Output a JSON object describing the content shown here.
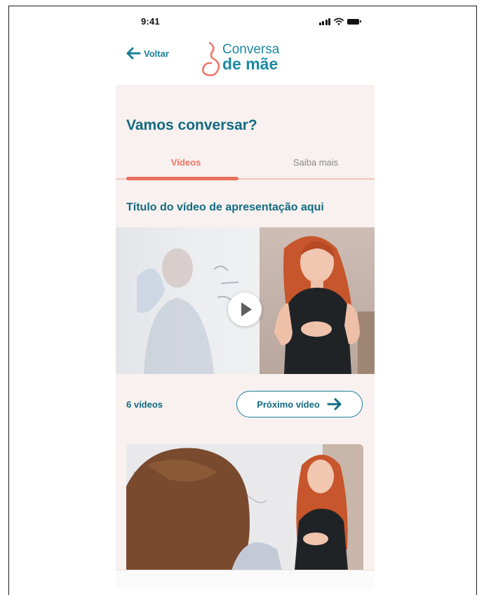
{
  "status_bar": {
    "time": "9:41",
    "icons": [
      "signal-icon",
      "wifi-icon",
      "battery-icon"
    ]
  },
  "header": {
    "back_label": "Voltar",
    "logo_line1": "Conversa",
    "logo_line2": "de mãe"
  },
  "page": {
    "title": "Vamos conversar?"
  },
  "tabs": [
    {
      "label": "Vídeos",
      "active": true
    },
    {
      "label": "Saiba mais",
      "active": false
    }
  ],
  "featured_video": {
    "title": "Título do vídeo de apresentação aqui"
  },
  "playlist": {
    "count_label": "6 vídeos",
    "next_label": "Próximo vídeo"
  },
  "colors": {
    "brand_teal": "#126b82",
    "accent_coral": "#ec6e5c",
    "content_background": "#f8f1ef"
  }
}
